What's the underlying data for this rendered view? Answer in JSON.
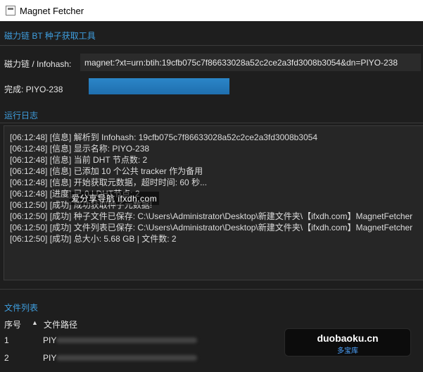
{
  "window": {
    "title": "Magnet Fetcher",
    "icon": "app-window-icon"
  },
  "header": {
    "title": "磁力链 BT 种子获取工具"
  },
  "magnet": {
    "label": "磁力链 / Infohash:",
    "value": "magnet:?xt=urn:btih:19cfb075c7f86633028a52c2ce2a3fd3008b3054&dn=PIYO-238"
  },
  "status": {
    "label": "完成: PIYO-238",
    "progress": 1.0
  },
  "log": {
    "title": "运行日志",
    "lines": [
      "[06:12:48] [信息] 解析到 Infohash: 19cfb075c7f86633028a52c2ce2a3fd3008b3054",
      "[06:12:48] [信息] 显示名称: PIYO-238",
      "[06:12:48] [信息] 当前 DHT 节点数: 2",
      "[06:12:48] [信息] 已添加 10 个公共 tracker 作为备用",
      "[06:12:48] [信息] 开始获取元数据，超时时间: 60 秒...",
      "[06:12:48] [进度] 已                  0 | DHT节点: 2",
      "[06:12:50] [成功] 成功获取种子元数据!",
      "[06:12:50] [成功] 种子文件已保存: C:\\Users\\Administrator\\Desktop\\新建文件夹\\【ifxdh.com】MagnetFetcher",
      "[06:12:50] [成功] 文件列表已保存: C:\\Users\\Administrator\\Desktop\\新建文件夹\\【ifxdh.com】MagnetFetcher",
      "[06:12:50] [成功] 总大小: 5.68 GB | 文件数: 2"
    ]
  },
  "watermark": {
    "text": "爱分享导航 ifxdh.com"
  },
  "files": {
    "title": "文件列表",
    "columns": {
      "num": "序号",
      "sort_icon": "▲",
      "path": "文件路径"
    },
    "rows": [
      {
        "num": "1",
        "path": "PIY"
      },
      {
        "num": "2",
        "path": "PIY"
      }
    ]
  },
  "brand": {
    "main": "duobaoku.cn",
    "sub": "多宝库"
  },
  "colors": {
    "accent": "#3f9fe0",
    "progress": "#1f6fae",
    "background": "#1e1e1e"
  }
}
